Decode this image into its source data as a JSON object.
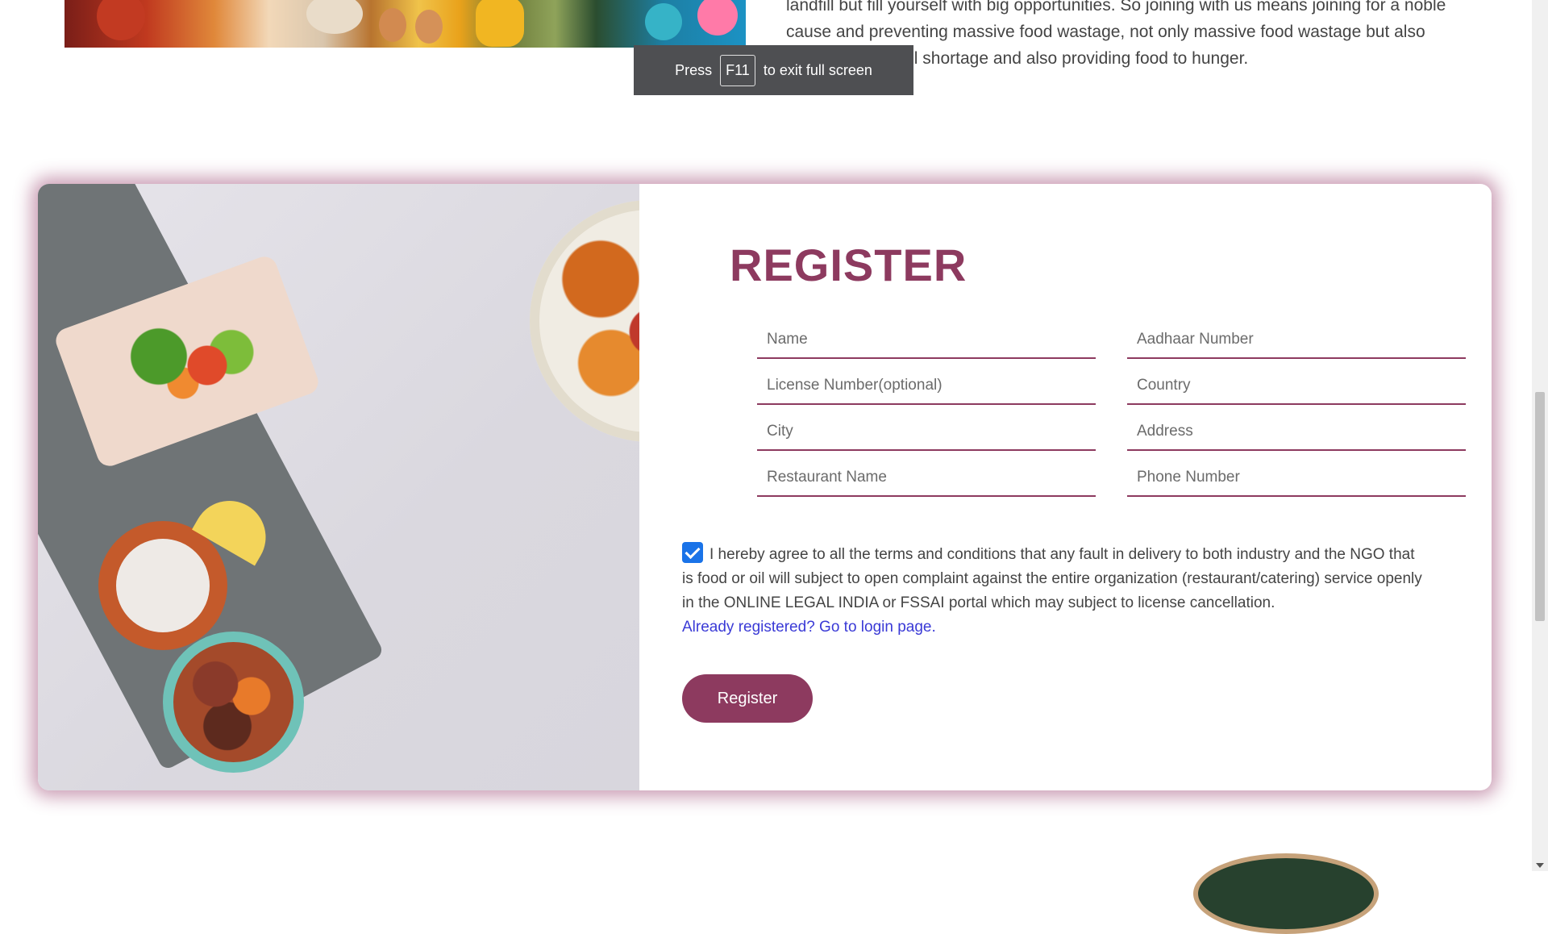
{
  "about": {
    "text": "landfill but fill yourself with big opportunities. So joining with us means joining for a noble cause and preventing massive food wastage, not only massive food wastage but also preventing landfill shortage and also providing food to hunger."
  },
  "fullscreen_toast": {
    "prefix": "Press",
    "key": "F11",
    "suffix": "to exit full screen"
  },
  "register": {
    "title": "REGISTER",
    "fields": {
      "name": "Name",
      "aadhaar": "Aadhaar Number",
      "license": "License Number(optional)",
      "country": "Country",
      "city": "City",
      "address": "Address",
      "restaurant": "Restaurant Name",
      "phone": "Phone Number"
    },
    "terms_checked": true,
    "terms_text": "I hereby agree to all the terms and conditions that any fault in delivery to both industry and the NGO that is food or oil will subject to open complaint against the entire organization (restaurant/catering) service openly in the ONLINE LEGAL INDIA or FSSAI portal which may subject to license cancellation.",
    "login_link": "Already registered? Go to login page.",
    "button_label": "Register"
  },
  "colors": {
    "accent": "#8d3a5f",
    "link": "#3a3ad6",
    "checkbox": "#1a73e8",
    "toast_bg": "#4e4f52"
  },
  "icons": [
    "checkmark-icon",
    "scroll-down-arrow-icon"
  ]
}
